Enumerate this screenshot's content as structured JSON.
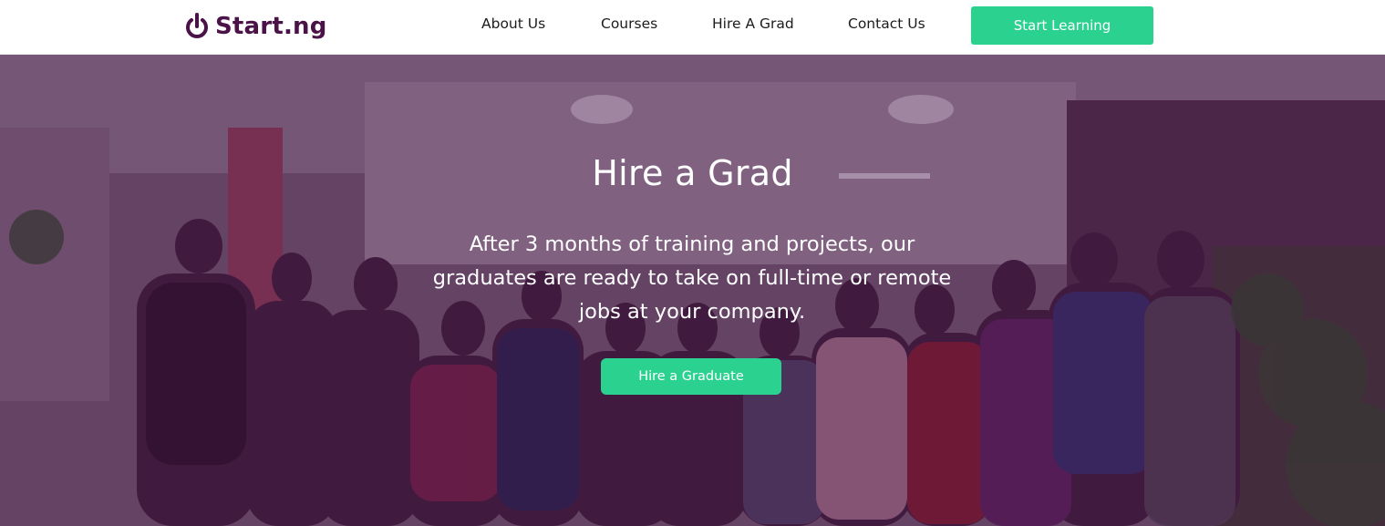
{
  "header": {
    "brand": "Start.ng",
    "logo_icon": "power-icon",
    "brand_color": "#4b1247",
    "nav": {
      "about": "About Us",
      "courses": "Courses",
      "hire": "Hire A Grad",
      "contact": "Contact Us"
    },
    "cta_label": "Start Learning",
    "accent_color": "#2bd18f"
  },
  "hero": {
    "title": "Hire a Grad",
    "description": "After 3 months of training and projects, our graduates are ready to take on full-time or remote jobs at your company.",
    "button_label": "Hire a Graduate",
    "overlay_color": "#50144e"
  }
}
